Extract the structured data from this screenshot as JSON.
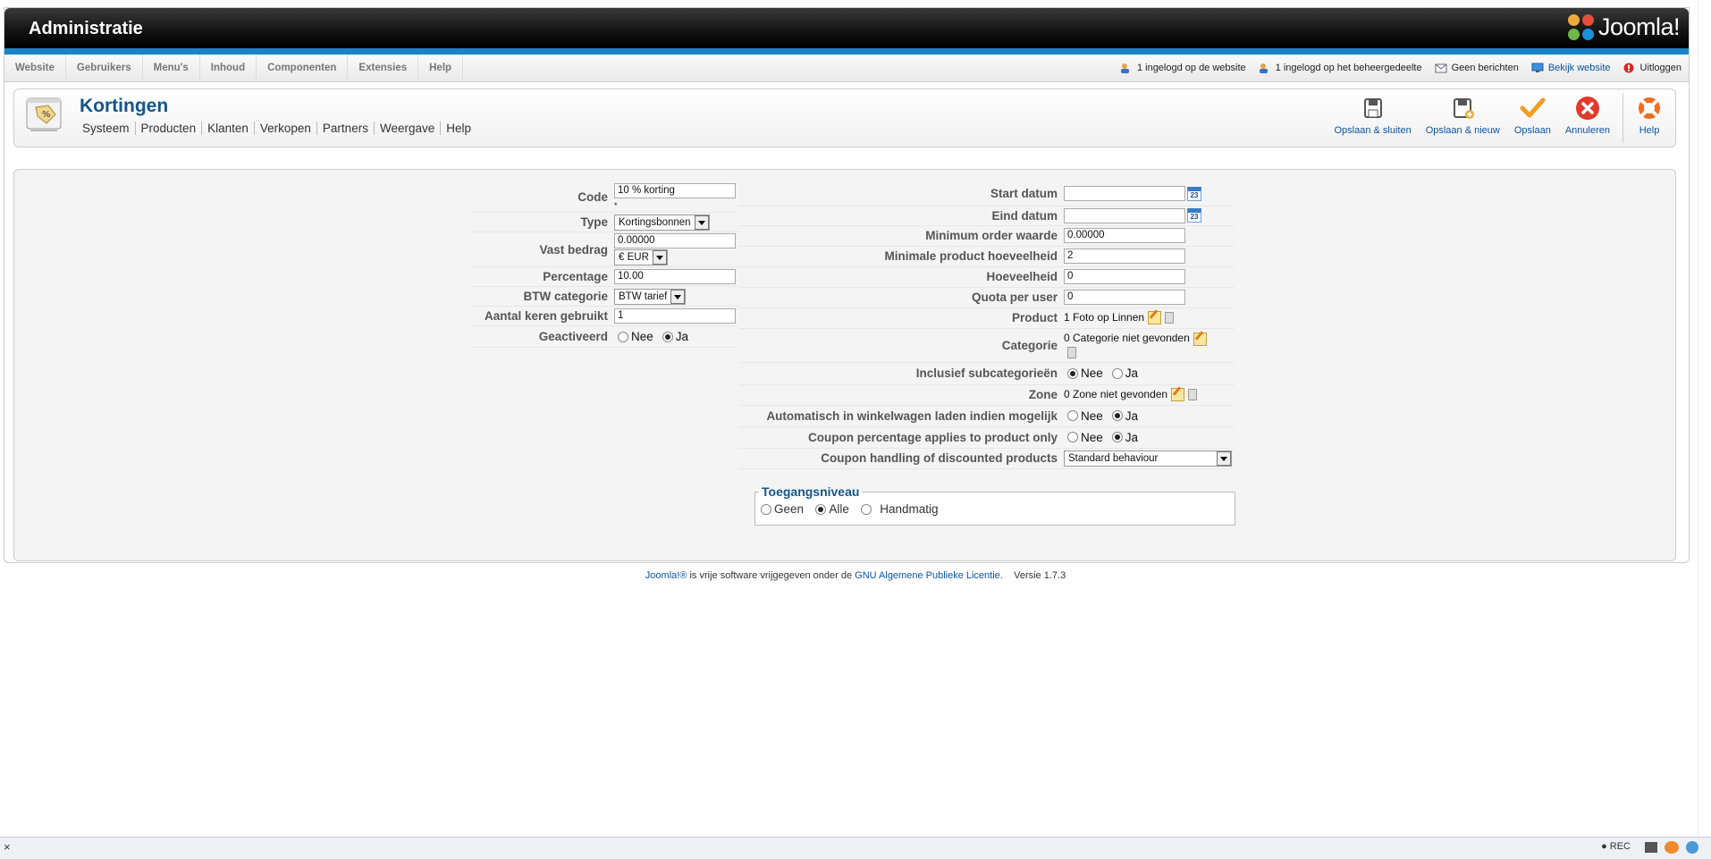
{
  "header": {
    "title": "Administratie",
    "logo_text": "Joomla!"
  },
  "menu": [
    "Website",
    "Gebruikers",
    "Menu's",
    "Inhoud",
    "Componenten",
    "Extensies",
    "Help"
  ],
  "status": {
    "site_users": "1 ingelogd op de website",
    "admin_users": "1 ingelogd op het beheergedeelte",
    "messages": "Geen berichten",
    "view_site": "Bekijk website",
    "logout": "Uitloggen"
  },
  "component": {
    "title": "Kortingen",
    "submenu": [
      "Systeem",
      "Producten",
      "Klanten",
      "Verkopen",
      "Partners",
      "Weergave",
      "Help"
    ]
  },
  "toolbar": {
    "save_close": "Opslaan & sluiten",
    "save_new": "Opslaan & nieuw",
    "save": "Opslaan",
    "cancel": "Annuleren",
    "help": "Help"
  },
  "form_left": {
    "code_label": "Code",
    "code_value": "10 % korting",
    "code_required": "*",
    "type_label": "Type",
    "type_value": "Kortingsbonnen",
    "fixed_label": "Vast bedrag",
    "fixed_value": "0.00000",
    "currency_value": "€ EUR",
    "percentage_label": "Percentage",
    "percentage_value": "10.00",
    "tax_label": "BTW categorie",
    "tax_value": "BTW tarief",
    "used_label": "Aantal keren gebruikt",
    "used_value": "1",
    "active_label": "Geactiveerd",
    "no": "Nee",
    "yes": "Ja",
    "active_selected": "Ja"
  },
  "form_right": {
    "start_label": "Start datum",
    "start_value": "",
    "calendar_day": "23",
    "end_label": "Eind datum",
    "end_value": "",
    "min_order_label": "Minimum order waarde",
    "min_order_value": "0.00000",
    "min_qty_label": "Minimale product hoeveelheid",
    "min_qty_value": "2",
    "qty_label": "Hoeveelheid",
    "qty_value": "0",
    "quota_label": "Quota per user",
    "quota_value": "0",
    "product_label": "Product",
    "product_value": "1 Foto op Linnen",
    "category_label": "Categorie",
    "category_value": "0 Categorie niet gevonden",
    "subcat_label": "Inclusief subcategorieën",
    "subcat_selected": "Nee",
    "zone_label": "Zone",
    "zone_value": "0 Zone niet gevonden",
    "autoload_label": "Automatisch in winkelwagen laden indien mogelijk",
    "autoload_selected": "Ja",
    "coupon_pct_label": "Coupon percentage applies to product only",
    "coupon_pct_selected": "Ja",
    "coupon_handling_label": "Coupon handling of discounted products",
    "coupon_handling_value": "Standard behaviour",
    "no": "Nee",
    "yes": "Ja"
  },
  "access": {
    "legend": "Toegangsniveau",
    "options": [
      "Geen",
      "Alle",
      "Handmatig"
    ],
    "selected": "Alle"
  },
  "footer": {
    "joomla_link": "Joomla!®",
    "text1": " is vrije software vrijgegeven onder de ",
    "license_link": "GNU Algemene Publieke Licentie",
    "text2": ".",
    "version": "Versie 1.7.3"
  },
  "browser": {
    "close": "×",
    "rec": "● REC"
  }
}
